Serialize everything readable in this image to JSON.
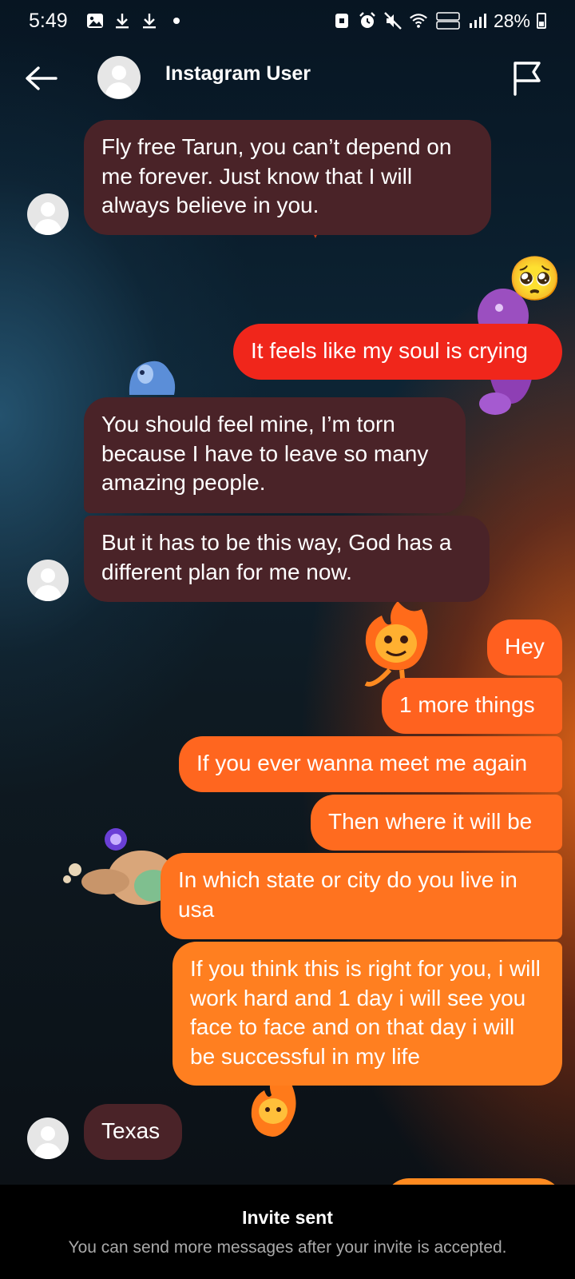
{
  "status_bar": {
    "time": "5:49",
    "battery": "28%",
    "left_icons": [
      "gallery-icon",
      "download-icon",
      "download-icon",
      "dot-icon"
    ],
    "right_icons": [
      "nfc-icon",
      "alarm-icon",
      "mute-icon",
      "wifi-icon",
      "volte-icon",
      "signal-icon",
      "battery-icon"
    ]
  },
  "header": {
    "title": "Instagram User"
  },
  "messages": [
    {
      "side": "received",
      "text": "Fly free Tarun, you can’t depend on me forever. Just know that I will always believe in you."
    },
    {
      "side": "sent",
      "reaction": "pleading-face",
      "text": "It feels like my soul is crying"
    },
    {
      "side": "received",
      "text": "You should feel mine, I’m torn because I have to leave so many amazing people."
    },
    {
      "side": "received",
      "text": "But it has to be this way, God has a different plan for me now."
    },
    {
      "side": "sent",
      "text": "Hey"
    },
    {
      "side": "sent",
      "text": "1 more things"
    },
    {
      "side": "sent",
      "text": "If you ever wanna meet me again"
    },
    {
      "side": "sent",
      "text": "Then where it will be"
    },
    {
      "side": "sent",
      "text": "In which state or city do you live in usa"
    },
    {
      "side": "sent",
      "text": "If you think this is right for you, i will work hard and 1 day i will see you face to face and on that day i will be successful in my life"
    },
    {
      "side": "received",
      "text": "Texas"
    }
  ],
  "reaction_emoji": "🥺",
  "footer": {
    "title": "Invite sent",
    "subtitle": "You can send more messages after your invite is accepted."
  },
  "colors": {
    "received_bubble": "#4a2328",
    "sent_red": "#f0261b",
    "sent_orange_top": "#ff5f1f",
    "sent_orange_bottom": "#ff8520"
  }
}
